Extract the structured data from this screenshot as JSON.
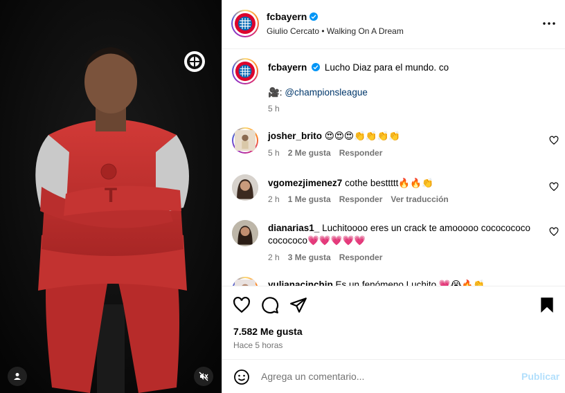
{
  "post": {
    "username": "fcbayern",
    "audio": "Giulio Cercato • Walking On A Dream",
    "caption": "Lucho Diaz para el mundo. co",
    "credit_prefix": "🎥: ",
    "credit_mention": "@championsleague",
    "caption_time": "5 h"
  },
  "comments": [
    {
      "user": "josher_brito",
      "text": "😍😍😍👏👏👏👏",
      "time": "5 h",
      "likes": "2 Me gusta",
      "reply": "Responder",
      "translate": ""
    },
    {
      "user": "vgomezjimenez7",
      "text": "cothe besttttt🔥🔥👏",
      "time": "2 h",
      "likes": "1 Me gusta",
      "reply": "Responder",
      "translate": "Ver traducción"
    },
    {
      "user": "dianarias1_",
      "text": "Luchitoooo eres un crack te amooooo cococococo cocococo💗💗💗💗💗",
      "time": "2 h",
      "likes": "3 Me gusta",
      "reply": "Responder",
      "translate": ""
    },
    {
      "user": "yulianacinchip",
      "text": "Es un fenómeno Luchito 💗😭🔥👏",
      "time": "",
      "likes": "",
      "reply": "",
      "translate": ""
    }
  ],
  "stats": {
    "likes": "7.582 Me gusta",
    "when": "Hace 5 horas"
  },
  "composer": {
    "placeholder": "Agrega un comentario...",
    "post_label": "Publicar"
  },
  "icons": {
    "verified": "verified-badge-icon",
    "more": "more-options-icon",
    "like": "heart-icon",
    "comment": "comment-icon",
    "share": "share-icon",
    "save": "bookmark-icon",
    "emoji": "emoji-icon",
    "user": "user-icon",
    "mute": "muted-speaker-icon"
  },
  "colors": {
    "verified": "#0095f6",
    "link": "#00376b",
    "muted_text": "#737373",
    "post_disabled": "#b2dffc",
    "jersey": "#c8302f"
  }
}
